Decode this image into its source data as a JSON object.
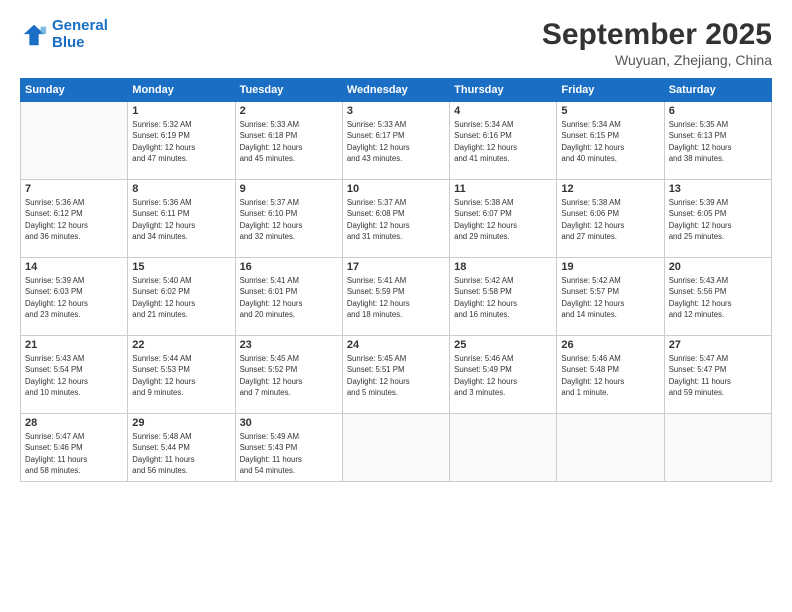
{
  "header": {
    "logo_line1": "General",
    "logo_line2": "Blue",
    "month": "September 2025",
    "location": "Wuyuan, Zhejiang, China"
  },
  "weekdays": [
    "Sunday",
    "Monday",
    "Tuesday",
    "Wednesday",
    "Thursday",
    "Friday",
    "Saturday"
  ],
  "weeks": [
    [
      {
        "day": "",
        "info": ""
      },
      {
        "day": "1",
        "info": "Sunrise: 5:32 AM\nSunset: 6:19 PM\nDaylight: 12 hours\nand 47 minutes."
      },
      {
        "day": "2",
        "info": "Sunrise: 5:33 AM\nSunset: 6:18 PM\nDaylight: 12 hours\nand 45 minutes."
      },
      {
        "day": "3",
        "info": "Sunrise: 5:33 AM\nSunset: 6:17 PM\nDaylight: 12 hours\nand 43 minutes."
      },
      {
        "day": "4",
        "info": "Sunrise: 5:34 AM\nSunset: 6:16 PM\nDaylight: 12 hours\nand 41 minutes."
      },
      {
        "day": "5",
        "info": "Sunrise: 5:34 AM\nSunset: 6:15 PM\nDaylight: 12 hours\nand 40 minutes."
      },
      {
        "day": "6",
        "info": "Sunrise: 5:35 AM\nSunset: 6:13 PM\nDaylight: 12 hours\nand 38 minutes."
      }
    ],
    [
      {
        "day": "7",
        "info": "Sunrise: 5:36 AM\nSunset: 6:12 PM\nDaylight: 12 hours\nand 36 minutes."
      },
      {
        "day": "8",
        "info": "Sunrise: 5:36 AM\nSunset: 6:11 PM\nDaylight: 12 hours\nand 34 minutes."
      },
      {
        "day": "9",
        "info": "Sunrise: 5:37 AM\nSunset: 6:10 PM\nDaylight: 12 hours\nand 32 minutes."
      },
      {
        "day": "10",
        "info": "Sunrise: 5:37 AM\nSunset: 6:08 PM\nDaylight: 12 hours\nand 31 minutes."
      },
      {
        "day": "11",
        "info": "Sunrise: 5:38 AM\nSunset: 6:07 PM\nDaylight: 12 hours\nand 29 minutes."
      },
      {
        "day": "12",
        "info": "Sunrise: 5:38 AM\nSunset: 6:06 PM\nDaylight: 12 hours\nand 27 minutes."
      },
      {
        "day": "13",
        "info": "Sunrise: 5:39 AM\nSunset: 6:05 PM\nDaylight: 12 hours\nand 25 minutes."
      }
    ],
    [
      {
        "day": "14",
        "info": "Sunrise: 5:39 AM\nSunset: 6:03 PM\nDaylight: 12 hours\nand 23 minutes."
      },
      {
        "day": "15",
        "info": "Sunrise: 5:40 AM\nSunset: 6:02 PM\nDaylight: 12 hours\nand 21 minutes."
      },
      {
        "day": "16",
        "info": "Sunrise: 5:41 AM\nSunset: 6:01 PM\nDaylight: 12 hours\nand 20 minutes."
      },
      {
        "day": "17",
        "info": "Sunrise: 5:41 AM\nSunset: 5:59 PM\nDaylight: 12 hours\nand 18 minutes."
      },
      {
        "day": "18",
        "info": "Sunrise: 5:42 AM\nSunset: 5:58 PM\nDaylight: 12 hours\nand 16 minutes."
      },
      {
        "day": "19",
        "info": "Sunrise: 5:42 AM\nSunset: 5:57 PM\nDaylight: 12 hours\nand 14 minutes."
      },
      {
        "day": "20",
        "info": "Sunrise: 5:43 AM\nSunset: 5:56 PM\nDaylight: 12 hours\nand 12 minutes."
      }
    ],
    [
      {
        "day": "21",
        "info": "Sunrise: 5:43 AM\nSunset: 5:54 PM\nDaylight: 12 hours\nand 10 minutes."
      },
      {
        "day": "22",
        "info": "Sunrise: 5:44 AM\nSunset: 5:53 PM\nDaylight: 12 hours\nand 9 minutes."
      },
      {
        "day": "23",
        "info": "Sunrise: 5:45 AM\nSunset: 5:52 PM\nDaylight: 12 hours\nand 7 minutes."
      },
      {
        "day": "24",
        "info": "Sunrise: 5:45 AM\nSunset: 5:51 PM\nDaylight: 12 hours\nand 5 minutes."
      },
      {
        "day": "25",
        "info": "Sunrise: 5:46 AM\nSunset: 5:49 PM\nDaylight: 12 hours\nand 3 minutes."
      },
      {
        "day": "26",
        "info": "Sunrise: 5:46 AM\nSunset: 5:48 PM\nDaylight: 12 hours\nand 1 minute."
      },
      {
        "day": "27",
        "info": "Sunrise: 5:47 AM\nSunset: 5:47 PM\nDaylight: 11 hours\nand 59 minutes."
      }
    ],
    [
      {
        "day": "28",
        "info": "Sunrise: 5:47 AM\nSunset: 5:46 PM\nDaylight: 11 hours\nand 58 minutes."
      },
      {
        "day": "29",
        "info": "Sunrise: 5:48 AM\nSunset: 5:44 PM\nDaylight: 11 hours\nand 56 minutes."
      },
      {
        "day": "30",
        "info": "Sunrise: 5:49 AM\nSunset: 5:43 PM\nDaylight: 11 hours\nand 54 minutes."
      },
      {
        "day": "",
        "info": ""
      },
      {
        "day": "",
        "info": ""
      },
      {
        "day": "",
        "info": ""
      },
      {
        "day": "",
        "info": ""
      }
    ]
  ]
}
